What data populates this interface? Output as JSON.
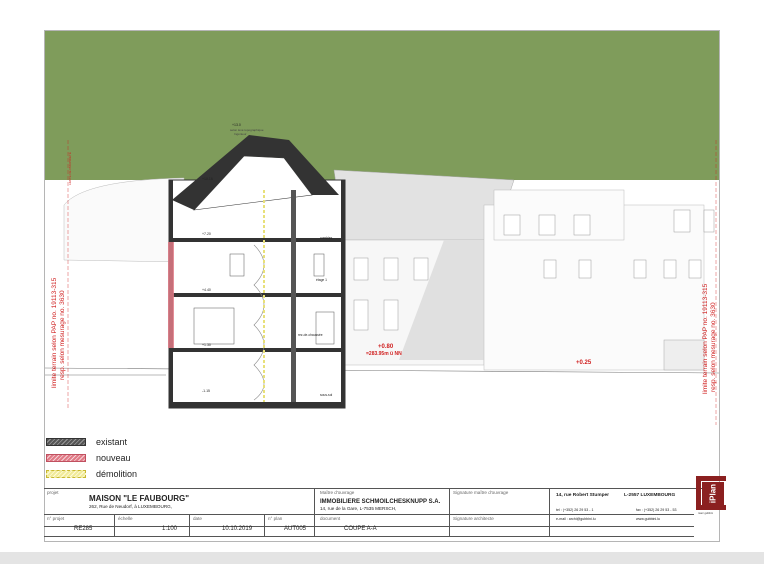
{
  "drawing": {
    "labels": {
      "ridge_top": "+13.0",
      "ridge_sub": "selon levé topographique",
      "ridge_sub2": "Ingénieur",
      "level_1": "+10.16",
      "level_2": "+7.20",
      "level_3": "+4.40",
      "level_4": "+1.30",
      "level_5": "-1.15",
      "level_ground": "+0.80",
      "level_nn": "=283.95m ü NN",
      "level_right": "+0.25",
      "room_1": "combles",
      "room_2": "étage 1",
      "room_3": "rez-de-chaussée",
      "room_4": "sous-sol",
      "limit_left": "limite terrain selon PAP no. 19113-315",
      "limit_left_2": "resp. selon mesurage no. 3630",
      "limit_right": "limite terrain selon PAP no. 19113-315",
      "limit_right_2": "resp. selon mesurage no. 3630",
      "limit_tag": "LIMITE DE PROPRIÉTÉ"
    }
  },
  "legend": [
    {
      "label": "existant",
      "color": "#555555"
    },
    {
      "label": "nouveau",
      "color": "#e07a86"
    },
    {
      "label": "démolition",
      "color": "#e8e07a"
    }
  ],
  "titleblock": {
    "projet_label": "projet",
    "projet_title": "MAISON \"LE FAUBOURG\"",
    "projet_address": "262, Rue de Neudorf, à LUXEMBOURG,",
    "maitre_label": "Maître d'ouvrage",
    "maitre_name": "IMMOBILIERE SCHMOILCHESKNUPP S.A.",
    "maitre_address": "14, rue de la Gare, L-7535 MERSCH,",
    "sig_maitre_label": "Signature maître d'ouvrage",
    "sig_archi_label": "Signature architecte",
    "archi_street": "14, rue Robert Stumper",
    "archi_city": "L-2557 LUXEMBOURG",
    "archi_tel": "tel : (+352) 26 29 53 - 1",
    "archi_fax": "fax : (+352) 26 29 53 - 53",
    "archi_email": "e-mail : archi@gubbini.lu",
    "archi_web": "www.gubbini.lu",
    "logo_text": "iPlan",
    "logo_sub": "marc gubbini",
    "no_projet_label": "n° projet",
    "no_projet": "RE285",
    "echelle_label": "échelle",
    "echelle": "1:100",
    "date_label": "date",
    "date": "10.10.2019",
    "no_plan_label": "n° plan",
    "no_plan": "AUT005",
    "document_label": "document",
    "document": "COUPE A-A"
  },
  "colors": {
    "sky_green": "#7f9c5b",
    "wall_dark": "#333333",
    "new_red": "#e07a86",
    "level_red": "#d02020",
    "logo_red": "#8b2020"
  }
}
